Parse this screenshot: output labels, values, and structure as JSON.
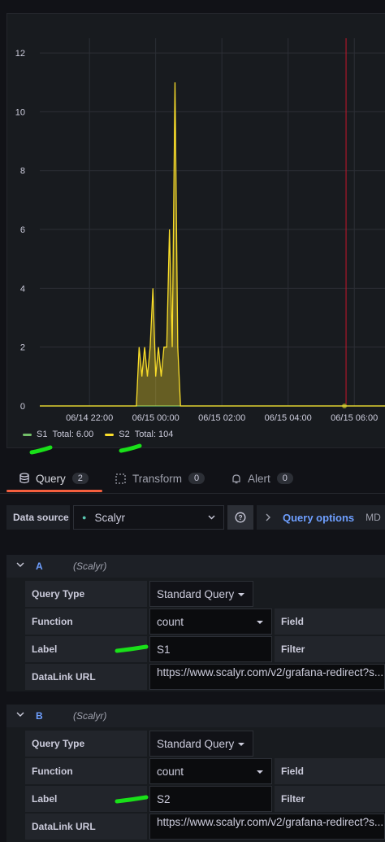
{
  "chart_data": {
    "type": "line",
    "yticks": [
      0,
      2,
      4,
      6,
      8,
      10,
      12
    ],
    "ylim": [
      0,
      12.5
    ],
    "xtick_labels": [
      "06/14 22:00",
      "06/15 00:00",
      "06/15 02:00",
      "06/15 04:00",
      "06/15 06:00"
    ],
    "series": [
      {
        "name": "S1",
        "color": "#73bf69",
        "x": [
          "06/14 20:30",
          "06/15 07:00"
        ],
        "values": [
          0,
          0
        ]
      },
      {
        "name": "S2",
        "color": "#fade2a",
        "x": [
          "06/14 20:30",
          "06/14 23:25",
          "06/14 23:30",
          "06/14 23:35",
          "06/14 23:40",
          "06/14 23:45",
          "06/14 23:50",
          "06/14 23:55",
          "06/15 00:00",
          "06/15 00:05",
          "06/15 00:10",
          "06/15 00:15",
          "06/15 00:20",
          "06/15 00:25",
          "06/15 00:30",
          "06/15 00:35",
          "06/15 00:40",
          "06/15 00:45",
          "06/15 00:50",
          "06/15 00:55",
          "06/15 07:00"
        ],
        "values": [
          0,
          0,
          2,
          1,
          2,
          1,
          2,
          4,
          1,
          2,
          1,
          2,
          2,
          6,
          2,
          11,
          2,
          0,
          0,
          0,
          0
        ]
      }
    ],
    "annotation_time": "06/15 05:45",
    "grid": true
  },
  "legend": [
    {
      "name": "S1",
      "total": "Total: 6.00",
      "color": "#73bf69"
    },
    {
      "name": "S2",
      "total": "Total: 104",
      "color": "#fade2a"
    }
  ],
  "tabs": [
    {
      "label": "Query",
      "count": "2",
      "icon": "database-icon"
    },
    {
      "label": "Transform",
      "count": "0",
      "icon": "transform-icon"
    },
    {
      "label": "Alert",
      "count": "0",
      "icon": "bell-icon"
    }
  ],
  "datasource": {
    "label": "Data source",
    "value": "Scalyr",
    "query_options": "Query options",
    "md": "MD"
  },
  "queries": [
    {
      "letter": "A",
      "datasource": "(Scalyr)",
      "query_type_label": "Query Type",
      "query_type": "Standard Query",
      "function_label": "Function",
      "function": "count",
      "field_label": "Field",
      "label_label": "Label",
      "label": "S1",
      "filter_label": "Filter",
      "datalink_label": "DataLink URL",
      "datalink": "https://www.scalyr.com/v2/grafana-redirect?s..."
    },
    {
      "letter": "B",
      "datasource": "(Scalyr)",
      "query_type_label": "Query Type",
      "query_type": "Standard Query",
      "function_label": "Function",
      "function": "count",
      "field_label": "Field",
      "label_label": "Label",
      "label": "S2",
      "filter_label": "Filter",
      "datalink_label": "DataLink URL",
      "datalink": "https://www.scalyr.com/v2/grafana-redirect?s..."
    }
  ],
  "colors": {
    "accent": "#6e9fff",
    "tab_underline": "#f55f3e",
    "annotation": "#c4162a",
    "scribble": "#19e019"
  }
}
